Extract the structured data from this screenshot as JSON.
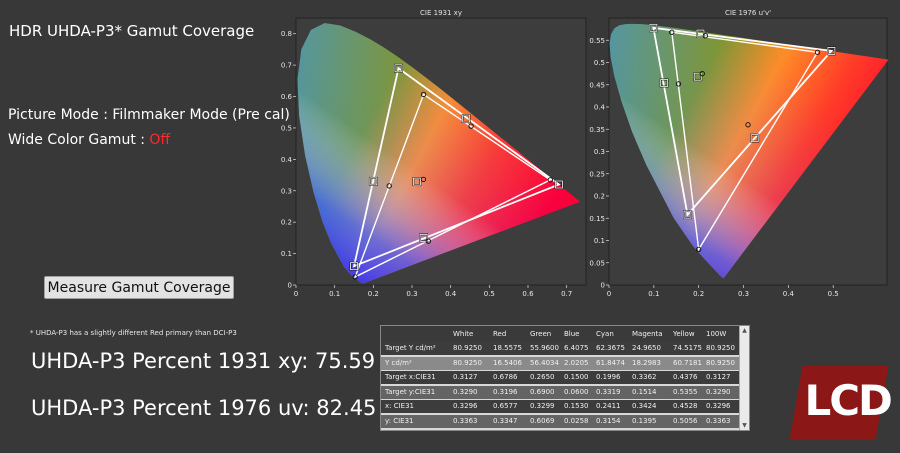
{
  "header": {
    "title": "HDR UHDA-P3* Gamut Coverage",
    "picture_mode": "Picture Mode : Filmmaker Mode (Pre cal)",
    "wide_gamut_label": "Wide Color Gamut : ",
    "wide_gamut_value": "Off"
  },
  "measure_button": "Measure Gamut Coverage",
  "footnote": "* UHDA-P3 has a slightly different Red primary than DCI-P3",
  "results": {
    "xy": "UHDA-P3 Percent 1931 xy: 75.59",
    "uv": "UHDA-P3 Percent 1976 uv: 82.45"
  },
  "colors": {
    "off": "#ff2a2a",
    "logo": "#8c1717",
    "background": "#383838"
  },
  "chart_data": [
    {
      "type": "scatter",
      "title": "CIE 1931 xy",
      "xlim": [
        0,
        0.75
      ],
      "ylim": [
        0,
        0.85
      ],
      "xticks": [
        "0",
        "0.1",
        "0.2",
        "0.3",
        "0.4",
        "0.5",
        "0.6",
        "0.7"
      ],
      "yticks": [
        "0",
        "0.1",
        "0.2",
        "0.3",
        "0.4",
        "0.5",
        "0.6",
        "0.7",
        "0.8"
      ],
      "target_gamut": [
        [
          0.68,
          0.32
        ],
        [
          0.265,
          0.69
        ],
        [
          0.15,
          0.06
        ]
      ],
      "measured_gamut": [
        [
          0.6577,
          0.3347
        ],
        [
          0.3299,
          0.6069
        ],
        [
          0.153,
          0.0258
        ]
      ],
      "target_points": [
        [
          0.68,
          0.32
        ],
        [
          0.265,
          0.69
        ],
        [
          0.15,
          0.06
        ],
        [
          0.2,
          0.33
        ],
        [
          0.33,
          0.15
        ],
        [
          0.44,
          0.53
        ],
        [
          0.3127,
          0.329
        ]
      ],
      "measured_points": [
        [
          0.6577,
          0.3347
        ],
        [
          0.3299,
          0.6069
        ],
        [
          0.153,
          0.0258
        ],
        [
          0.2411,
          0.3154
        ],
        [
          0.3424,
          0.1395
        ],
        [
          0.4528,
          0.5056
        ],
        [
          0.3296,
          0.3363
        ]
      ]
    },
    {
      "type": "scatter",
      "title": "CIE 1976 u'v'",
      "xlim": [
        0,
        0.62
      ],
      "ylim": [
        0,
        0.6
      ],
      "xticks": [
        "0",
        "0.1",
        "0.2",
        "0.3",
        "0.4",
        "0.5"
      ],
      "yticks": [
        "0",
        "0.05",
        "0.1",
        "0.15",
        "0.2",
        "0.25",
        "0.3",
        "0.35",
        "0.4",
        "0.45",
        "0.5",
        "0.55"
      ],
      "target_gamut": [
        [
          0.496,
          0.526
        ],
        [
          0.099,
          0.578
        ],
        [
          0.175,
          0.158
        ]
      ],
      "measured_gamut": [
        [
          0.465,
          0.523
        ],
        [
          0.14,
          0.568
        ],
        [
          0.2,
          0.08
        ]
      ],
      "target_points": [
        [
          0.496,
          0.526
        ],
        [
          0.099,
          0.578
        ],
        [
          0.175,
          0.158
        ],
        [
          0.123,
          0.454
        ],
        [
          0.325,
          0.33
        ],
        [
          0.204,
          0.565
        ],
        [
          0.198,
          0.468
        ]
      ],
      "measured_points": [
        [
          0.465,
          0.523
        ],
        [
          0.14,
          0.568
        ],
        [
          0.2,
          0.08
        ],
        [
          0.155,
          0.452
        ],
        [
          0.31,
          0.36
        ],
        [
          0.215,
          0.56
        ],
        [
          0.208,
          0.475
        ]
      ]
    }
  ],
  "table": {
    "columns": [
      "",
      "White",
      "Red",
      "Green",
      "Blue",
      "Cyan",
      "Magenta",
      "Yellow",
      "100W"
    ],
    "rows": [
      [
        "Target Y cd/m²",
        "80.9250",
        "18.5575",
        "55.9600",
        "6.4075",
        "62.3675",
        "24.9650",
        "74.5175",
        "80.9250"
      ],
      [
        "Y cd/m²",
        "80.9250",
        "16.5406",
        "56.4034",
        "2.0205",
        "61.8474",
        "18.2983",
        "60.7181",
        "80.9250"
      ],
      [
        "Target x:CIE31",
        "0.3127",
        "0.6786",
        "0.2650",
        "0.1500",
        "0.1996",
        "0.3362",
        "0.4376",
        "0.3127"
      ],
      [
        "Target y:CIE31",
        "0.3290",
        "0.3196",
        "0.6900",
        "0.0600",
        "0.3319",
        "0.1514",
        "0.5355",
        "0.3290"
      ],
      [
        "x: CIE31",
        "0.3296",
        "0.6577",
        "0.3299",
        "0.1530",
        "0.2411",
        "0.3424",
        "0.4528",
        "0.3296"
      ],
      [
        "y: CIE31",
        "0.3363",
        "0.3347",
        "0.6069",
        "0.0258",
        "0.3154",
        "0.1395",
        "0.5056",
        "0.3363"
      ]
    ]
  },
  "logo": {
    "text": "LCD"
  }
}
